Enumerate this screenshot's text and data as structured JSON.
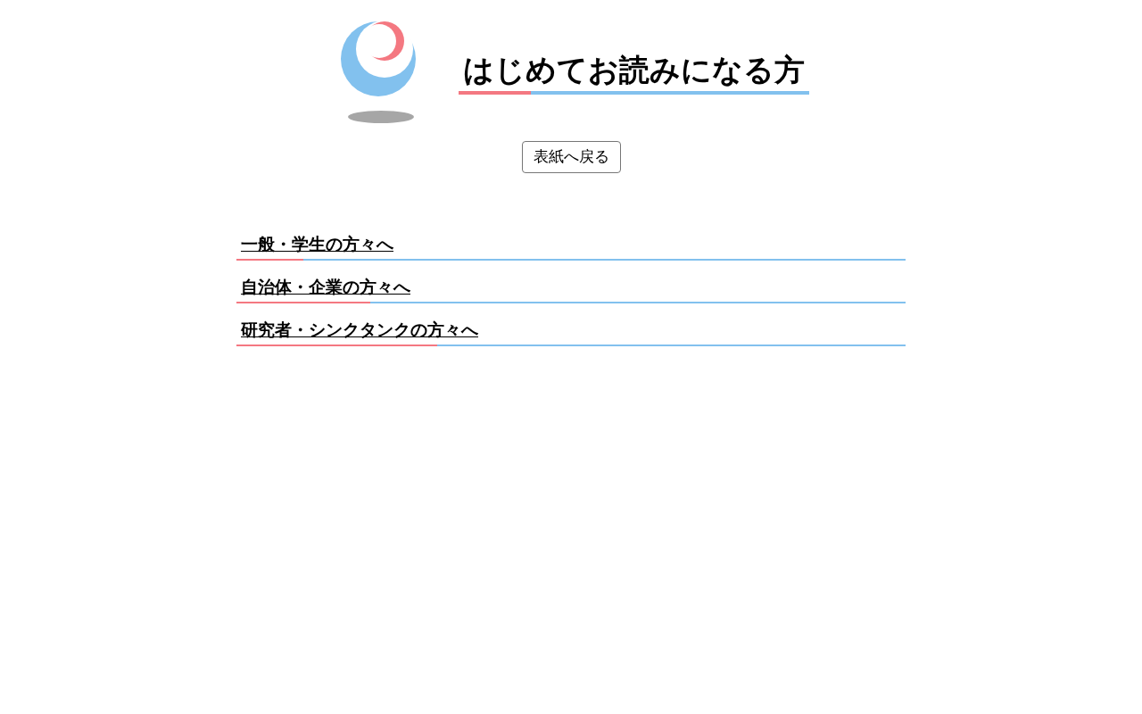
{
  "header": {
    "title": "はじめてお読みになる方"
  },
  "back_button": {
    "label": "表紙へ戻る"
  },
  "links": [
    {
      "label": "一般・学生の方々へ"
    },
    {
      "label": "自治体・企業の方々へ"
    },
    {
      "label": "研究者・シンクタンクの方々へ"
    }
  ]
}
